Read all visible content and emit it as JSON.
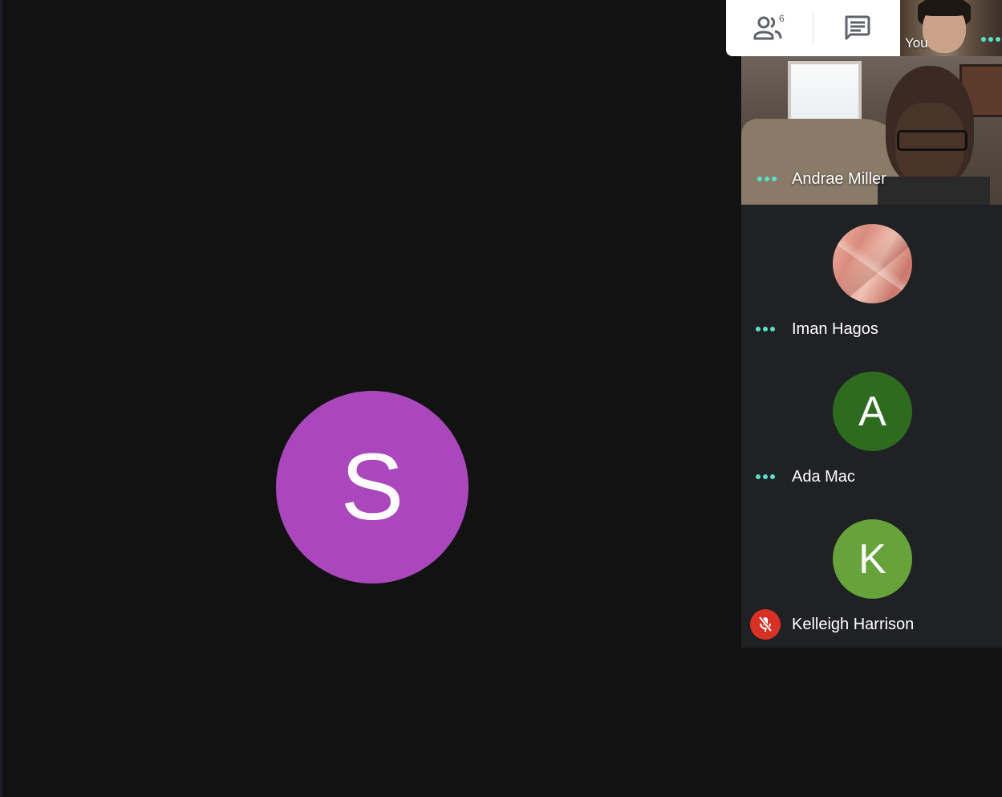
{
  "controls": {
    "people_icon": "people-icon",
    "people_count": "6",
    "chat_icon": "chat-icon"
  },
  "main": {
    "speaker_initial": "S",
    "speaker_color": "#ab47bc"
  },
  "self_tile": {
    "label": "You",
    "indicator": "more-dots-icon"
  },
  "participants": [
    {
      "name": "Andrae Miller",
      "type": "video",
      "indicator": "more-dots-icon"
    },
    {
      "name": "Iman Hagos",
      "type": "image-avatar",
      "indicator": "more-dots-icon"
    },
    {
      "name": "Ada Mac",
      "type": "initial-avatar",
      "initial": "A",
      "color": "#2e6b1f",
      "indicator": "more-dots-icon"
    },
    {
      "name": "Kelleigh Harrison",
      "type": "initial-avatar",
      "initial": "K",
      "color": "#67a33a",
      "indicator": "mic-off-icon"
    }
  ],
  "colors": {
    "background": "#121213",
    "tile_background": "#202124",
    "accent_dots": "#58e0c7",
    "muted_red": "#d93025"
  }
}
